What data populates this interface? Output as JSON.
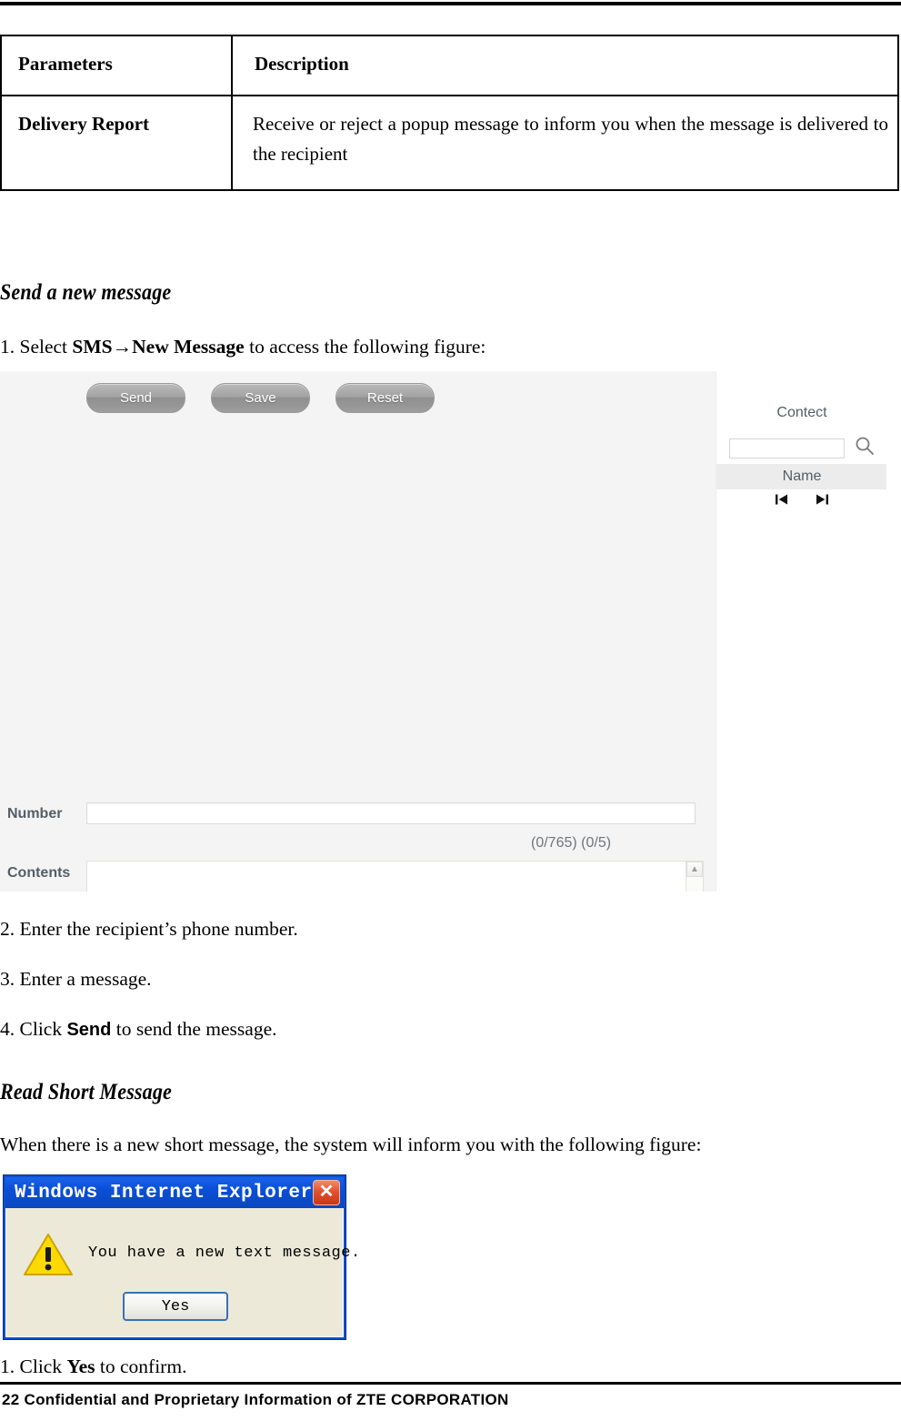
{
  "page": {
    "footer_text": "22 Confidential and Proprietary Information of ZTE CORPORATION"
  },
  "param_table": {
    "headers": [
      "Parameters",
      "Description"
    ],
    "rows": [
      {
        "parameter": "Delivery Report",
        "description": "Receive or reject a popup message to inform you when the message is delivered to the recipient"
      }
    ]
  },
  "sections": {
    "send_new_message": {
      "heading": "Send a new message",
      "step1_prefix": "1. Select ",
      "step1_bold": "SMS→New Message",
      "step1_suffix": " to access the following figure:",
      "step2": "2. Enter the recipient’s phone number.",
      "step3": "3. Enter a message.",
      "step4_prefix": "4. Click ",
      "step4_bold": "Send",
      "step4_suffix": " to send the message."
    },
    "read_short_message": {
      "heading": "Read Short Message",
      "intro": "When there is a new short message, the system will inform you with the following figure:",
      "step1_prefix": "1. Click ",
      "step1_bold": "Yes",
      "step1_suffix": " to confirm."
    }
  },
  "sms_figure": {
    "toolbar": {
      "send_label": "Send",
      "save_label": "Save",
      "reset_label": "Reset"
    },
    "number_label": "Number",
    "number_value": "",
    "counter": "(0/765) (0/5)",
    "contents_label": "Contents",
    "contents_value": "",
    "scrollbar": {
      "up_glyph": "▲",
      "down_glyph": "▼"
    },
    "contact_panel": {
      "title": "Contect",
      "search_value": "",
      "search_icon": "search-icon",
      "column_header": "Name",
      "first_page_glyph": "⏮",
      "last_page_glyph": "⏭"
    }
  },
  "ie_dialog": {
    "title": "Windows Internet Explorer",
    "close_label": "✕",
    "message": "You have a new text message.",
    "yes_label": "Yes",
    "colors": {
      "titlebar": "#0a4fd6",
      "body": "#ece9d8",
      "close_button": "#e2522c",
      "warning": "#ffd900"
    }
  }
}
